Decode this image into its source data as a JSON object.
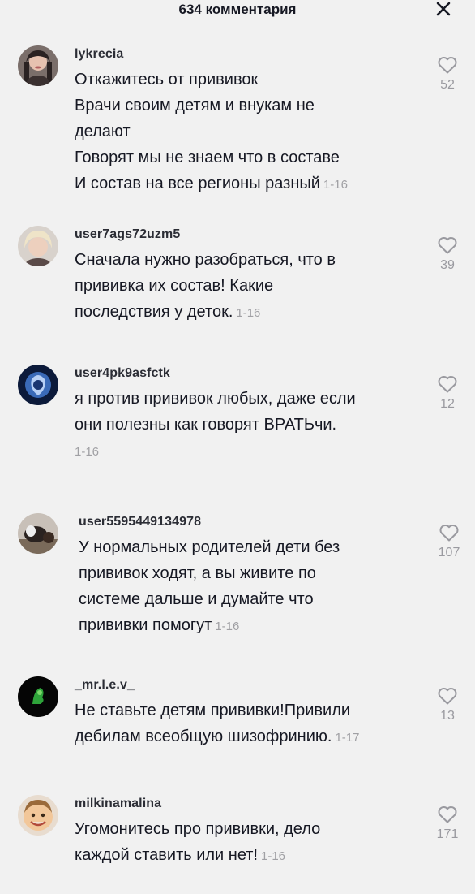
{
  "header": {
    "title": "634 комментария"
  },
  "comments": [
    {
      "username": "lykrecia",
      "lines": [
        "Откажитесь от прививок",
        "Врачи своим детям и внукам не",
        "делают",
        "Говорят мы не знаем что в составе",
        "И состав на все регионы разный"
      ],
      "date": "1-16",
      "likes": "52"
    },
    {
      "username": "user7ags72uzm5",
      "lines": [
        "Сначала нужно разобраться, что в",
        "прививка их состав! Какие",
        "последствия у деток."
      ],
      "date": "1-16",
      "likes": "39"
    },
    {
      "username": "user4pk9asfctk",
      "lines": [
        "я против прививок любых, даже если",
        "они полезны как говорят ВРАТЬчи."
      ],
      "date": "1-16",
      "likes": "12"
    },
    {
      "username": "user5595449134978",
      "lines": [
        "У нормальных родителей дети без",
        "прививок ходят, а вы живите по",
        "системе дальше и думайте что",
        "прививки помогут"
      ],
      "date": "1-16",
      "likes": "107"
    },
    {
      "username": "_mr.l.e.v_",
      "lines": [
        "Не ставьте детям прививки!Привили",
        "дебилам всеобщую шизофринию."
      ],
      "date": "1-17",
      "likes": "13"
    },
    {
      "username": "milkinamalina",
      "lines": [
        "Угомонитесь про прививки, дело",
        "каждой ставить или нет!"
      ],
      "date": "1-16",
      "likes": "171"
    }
  ]
}
